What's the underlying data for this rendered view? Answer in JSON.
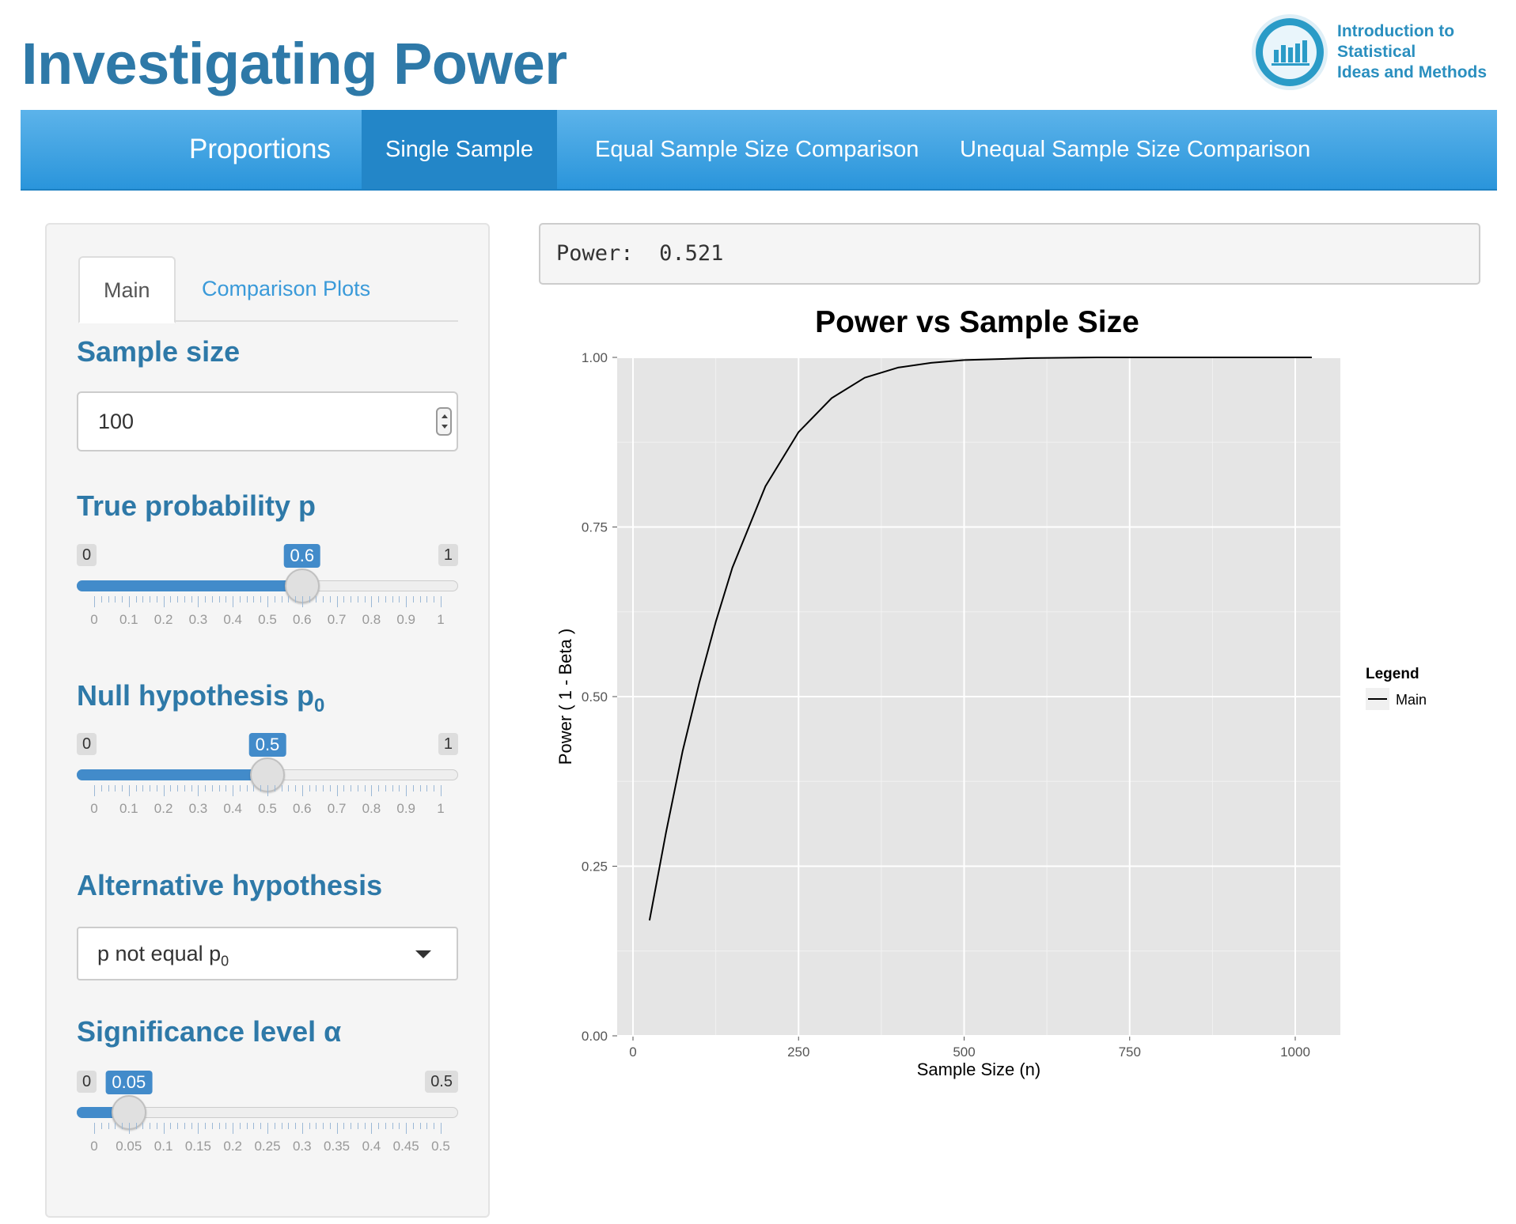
{
  "header": {
    "title": "Investigating Power",
    "logo_lines": [
      "Introduction to",
      "Statistical",
      "Ideas and Methods"
    ]
  },
  "nav": {
    "brand": "Proportions",
    "items": [
      "Single Sample",
      "Equal Sample Size Comparison",
      "Unequal Sample Size Comparison"
    ],
    "active": "Single Sample"
  },
  "sidebar": {
    "tabs": [
      "Main",
      "Comparison Plots"
    ],
    "sample_size": {
      "label": "Sample size",
      "value": "100"
    },
    "true_p": {
      "label": "True probability p",
      "min": "0",
      "max": "1",
      "value": "0.6",
      "tick_labels": [
        "0",
        "0.1",
        "0.2",
        "0.3",
        "0.4",
        "0.5",
        "0.6",
        "0.7",
        "0.8",
        "0.9",
        "1"
      ]
    },
    "null_p": {
      "label": "Null hypothesis p",
      "label_sub": "0",
      "min": "0",
      "max": "1",
      "value": "0.5",
      "tick_labels": [
        "0",
        "0.1",
        "0.2",
        "0.3",
        "0.4",
        "0.5",
        "0.6",
        "0.7",
        "0.8",
        "0.9",
        "1"
      ]
    },
    "alternative": {
      "label": "Alternative hypothesis",
      "value": "p not equal p",
      "value_sub": "0"
    },
    "alpha": {
      "label": "Significance level α",
      "min": "0",
      "max": "0.5",
      "value": "0.05",
      "tick_labels": [
        "0",
        "0.05",
        "0.1",
        "0.15",
        "0.2",
        "0.25",
        "0.3",
        "0.35",
        "0.4",
        "0.45",
        "0.5"
      ]
    }
  },
  "output": {
    "power_label": "Power:",
    "power_value": "0.521"
  },
  "colors": {
    "accent": "#2e79a8",
    "nav": "#2a95db",
    "slider": "#428bca",
    "plot_bg": "#e5e5e5"
  },
  "chart_data": {
    "type": "line",
    "title": "Power vs Sample Size",
    "xlabel": "Sample Size (n)",
    "ylabel": "Power ( 1 - Beta )",
    "xlim": [
      0,
      1000
    ],
    "ylim": [
      0,
      1
    ],
    "x_ticks": [
      "0",
      "250",
      "500",
      "750",
      "1000"
    ],
    "y_ticks": [
      "0.00",
      "0.25",
      "0.50",
      "0.75",
      "1.00"
    ],
    "legend": {
      "title": "Legend",
      "entries": [
        "Main"
      ],
      "placement": "right"
    },
    "series": [
      {
        "name": "Main",
        "color": "#000000",
        "x": [
          25,
          50,
          75,
          100,
          125,
          150,
          175,
          200,
          250,
          300,
          350,
          400,
          450,
          500,
          600,
          700,
          800,
          900,
          1000,
          1025
        ],
        "y": [
          0.17,
          0.3,
          0.42,
          0.52,
          0.61,
          0.69,
          0.75,
          0.81,
          0.89,
          0.94,
          0.97,
          0.985,
          0.992,
          0.996,
          0.999,
          1.0,
          1.0,
          1.0,
          1.0,
          1.0
        ]
      }
    ]
  }
}
